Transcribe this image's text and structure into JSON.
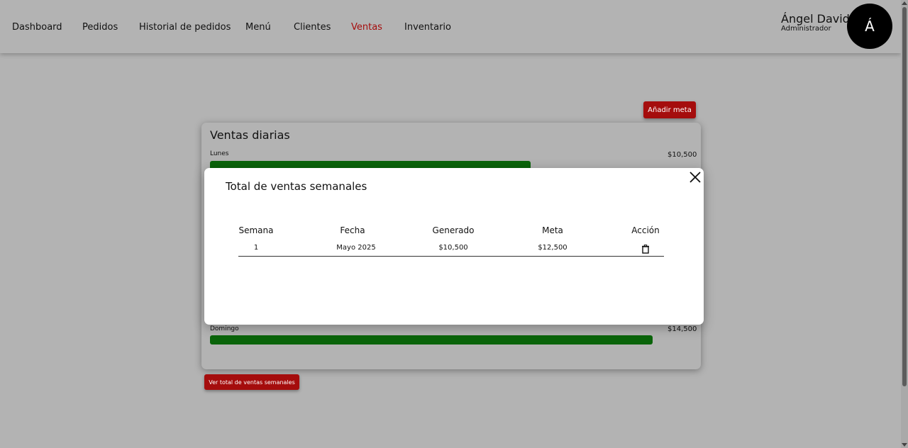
{
  "nav": {
    "items": [
      "Dashboard",
      "Pedidos",
      "Historial de pedidos",
      "Menú",
      "Clientes",
      "Ventas",
      "Inventario"
    ],
    "active_index": 5,
    "active_color": "#a50d0d"
  },
  "user": {
    "name": "Ángel David",
    "role": "Administrador",
    "avatar_initial": "Á"
  },
  "buttons": {
    "add_goal": "Añadir meta",
    "weekly_total": "Ver total de ventas semanales"
  },
  "daily_sales": {
    "title": "Ventas diarias",
    "bar_color": "#0a640a",
    "max_value": 15000,
    "days": [
      {
        "label": "Lunes",
        "amount": "$10,500",
        "value": 10500
      },
      {
        "label": "Domingo",
        "amount": "$14,500",
        "value": 14500
      }
    ]
  },
  "modal": {
    "title": "Total de ventas semanales",
    "columns": [
      "Semana",
      "Fecha",
      "Generado",
      "Meta",
      "Acción"
    ],
    "rows": [
      {
        "semana": "1",
        "fecha": "Mayo 2025",
        "generado": "$10,500",
        "meta": "$12,500",
        "action_icon": "trash-icon"
      }
    ],
    "close_icon": "close-icon"
  }
}
